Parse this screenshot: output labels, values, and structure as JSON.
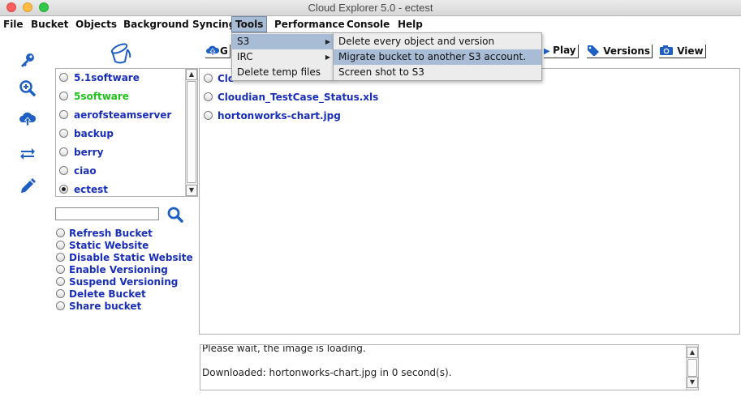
{
  "window": {
    "title": "Cloud Explorer 5.0 -  ectest"
  },
  "menubar": {
    "items": [
      "File",
      "Bucket",
      "Objects",
      "Background Syncing",
      "Tools",
      "Performance",
      "Console",
      "Help"
    ],
    "active": "Tools"
  },
  "tools_menu": {
    "items": [
      "S3",
      "IRC",
      "Delete temp files"
    ]
  },
  "s3_submenu": {
    "items": [
      "Delete every object and version",
      "Migrate bucket to another S3 account.",
      "Screen shot to S3"
    ],
    "highlighted": "Migrate bucket to another S3 account."
  },
  "left_toolbar": {
    "icons": [
      "key-icon",
      "zoom-in-icon",
      "cloud-upload-icon",
      "sync-arrows-icon",
      "pencil-icon"
    ]
  },
  "buckets": {
    "items": [
      "5.1software",
      "5software",
      "aerofsteamserver",
      "backup",
      "berry",
      "ciao",
      "ectest"
    ],
    "selected": "ectest",
    "highlight_color": "#22c21c"
  },
  "bucket_search": {
    "value": ""
  },
  "bucket_actions": [
    "Refresh Bucket",
    "Static Website",
    "Disable Static Website",
    "Enable Versioning",
    "Suspend Versioning",
    "Delete Bucket",
    "Share bucket"
  ],
  "object_toolbar": {
    "upload_label": "G",
    "play_label": "Play",
    "versions_label": "Versions",
    "view_label": "View"
  },
  "objects": {
    "items": [
      "Clo",
      "Cloudian_TestCase_Status.xls",
      "hortonworks-chart.jpg"
    ]
  },
  "log": {
    "lines": [
      "Please wait, the image is loading.",
      "Downloaded: hortonworks-chart.jpg in 0 second(s)."
    ]
  },
  "colors": {
    "link_blue": "#1a2fb8",
    "menu_highlight": "#a8bcd6"
  }
}
